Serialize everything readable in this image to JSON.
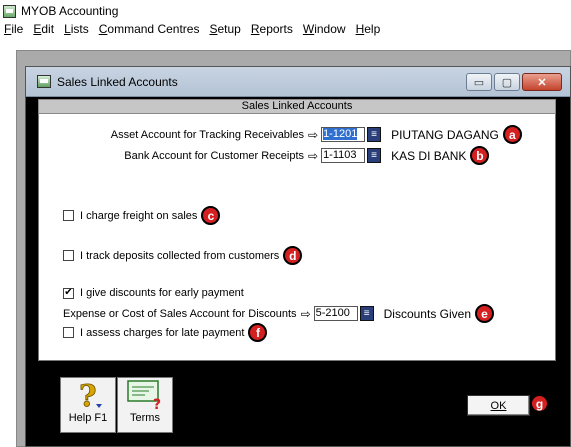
{
  "app": {
    "title": "MYOB Accounting"
  },
  "menu": [
    "File",
    "Edit",
    "Lists",
    "Command Centres",
    "Setup",
    "Reports",
    "Window",
    "Help"
  ],
  "menu_underline": [
    "F",
    "E",
    "L",
    "C",
    "S",
    "R",
    "W",
    "H"
  ],
  "dialog": {
    "title": "Sales Linked Accounts",
    "header": "Sales Linked Accounts",
    "window_buttons": {
      "minimize": "▭",
      "maximize": "▢",
      "close": "✕"
    }
  },
  "accounts": {
    "receivables": {
      "label": "Asset Account for Tracking Receivables",
      "code": "1-1201",
      "name": "PIUTANG DAGANG",
      "badge": "a"
    },
    "bank": {
      "label": "Bank Account for Customer Receipts",
      "code": "1-1103",
      "name": "KAS DI BANK",
      "badge": "b"
    },
    "discounts": {
      "label": "Expense or Cost of Sales Account for Discounts",
      "code": "5-2100",
      "name": "Discounts Given",
      "badge": "e"
    }
  },
  "options": {
    "freight": {
      "label": "I charge freight on sales",
      "checked": false,
      "badge": "c"
    },
    "deposits": {
      "label": "I track deposits collected from customers",
      "checked": false,
      "badge": "d"
    },
    "discounts": {
      "label": "I give discounts for early payment",
      "checked": true
    },
    "late": {
      "label": "I assess charges for late payment",
      "checked": false,
      "badge": "f"
    }
  },
  "arrow_glyph": "⇨",
  "lookup_glyph": "≡",
  "check_glyph": "✔",
  "toolbar": {
    "help_label": "Help F1",
    "terms_label": "Terms"
  },
  "ok": {
    "label": "OK",
    "badge": "g"
  }
}
